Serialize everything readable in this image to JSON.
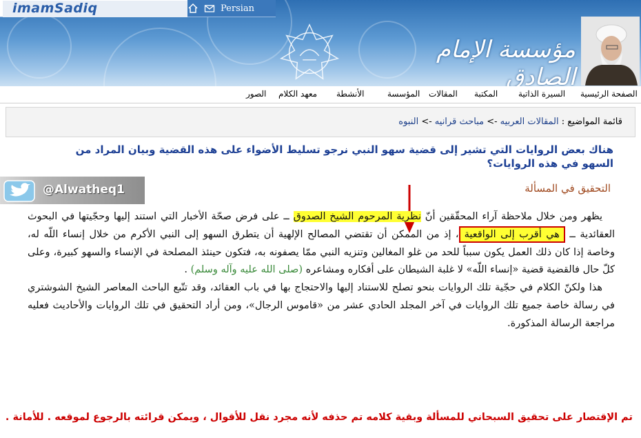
{
  "header": {
    "logo_text": "imamSadiq",
    "language_link": "Persian",
    "site_title": "مؤسسة الإمام الصادق",
    "home_icon": "home-icon",
    "mail_icon": "mail-icon",
    "emblem_icon": "calligraphy-emblem-icon"
  },
  "nav": {
    "items": [
      "الصفحة الرئيسية",
      "السيرة الذاتية",
      "المكتبة",
      "المقالات",
      "المؤسسة",
      "الأنشطة",
      "معهد الكلام",
      "الصور"
    ]
  },
  "breadcrumb": {
    "label": "قائمة المواضيع :",
    "links": [
      "المقالات العربيه",
      "مباحث قرانيه",
      "النبوه"
    ],
    "separator": "->"
  },
  "question": "هناك بعض الروايات التي تشير إلى قضية سهو النبي نرجو تسليط الأضواء على هذه القضية وبيان المراد من السهو في هذه الروايات؟",
  "twitter": {
    "handle": "@Alwatheq1",
    "icon": "twitter-bird-icon"
  },
  "section_heading": "التحقيق في المسألة",
  "paragraph1": {
    "p1": "يظهر ومن خلال ملاحظة آراء المحقّقين أنّ",
    "highlight1": "نظرية المرحوم الشيخ الصدوق",
    "p2": "ــ على فرض صحّة الأخبار التي استند إليها وحجّيتها في البحوث العقائدية ــ",
    "highlight2": "هي أقرب إلى الواقعية",
    "p3": "، إذ من الممكن أن تقتضي المصالح الإلهية أن يتطرق السهو إلى النبي الأكرم من خلال إنساء اللّه له، وخاصة إذا كان ذلك العمل يكون سبباً للحد من غلو المغالين وتنزيه النبي ممّا يصفونه به، فتكون حينئذ المصلحة في الإنساء والسهو كبيرة، وعلى كلّ حال فالقضية قضية «إنساء اللّه» لا غلبة الشيطان على أفكاره ومشاعره",
    "salawat": "(صلى الله عليه وآله وسلم)",
    "p4": "."
  },
  "paragraph2": "هذا ولكنّ الكلام في حجّية تلك الروايات بنحو تصلح للاستناد إليها والاحتجاج بها في باب العقائد، وقد تتّبع الباحث المعاصر الشيخ الشوشتري في رسالة خاصة جميع تلك الروايات في آخر المجلد الحادي عشر من «قاموس الرجال»، ومن أراد التحقيق في تلك الروايات والأحاديث فعليه مراجعة الرسالة المذكورة.",
  "footer_note": "تم الإقتصار على تحقيق السبحاني للمسألة وبقية كلامه تم حذفه لأنه مجرد نقل للأقوال ، ويمكن قرائته بالرجوع لموقعه . للأمانة .",
  "colors": {
    "question": "#1c3f94",
    "heading": "#a04a20",
    "highlight": "#ffff33",
    "box_border": "#cc0000",
    "footer": "#cc0000",
    "salawat": "#3a8a3a"
  }
}
